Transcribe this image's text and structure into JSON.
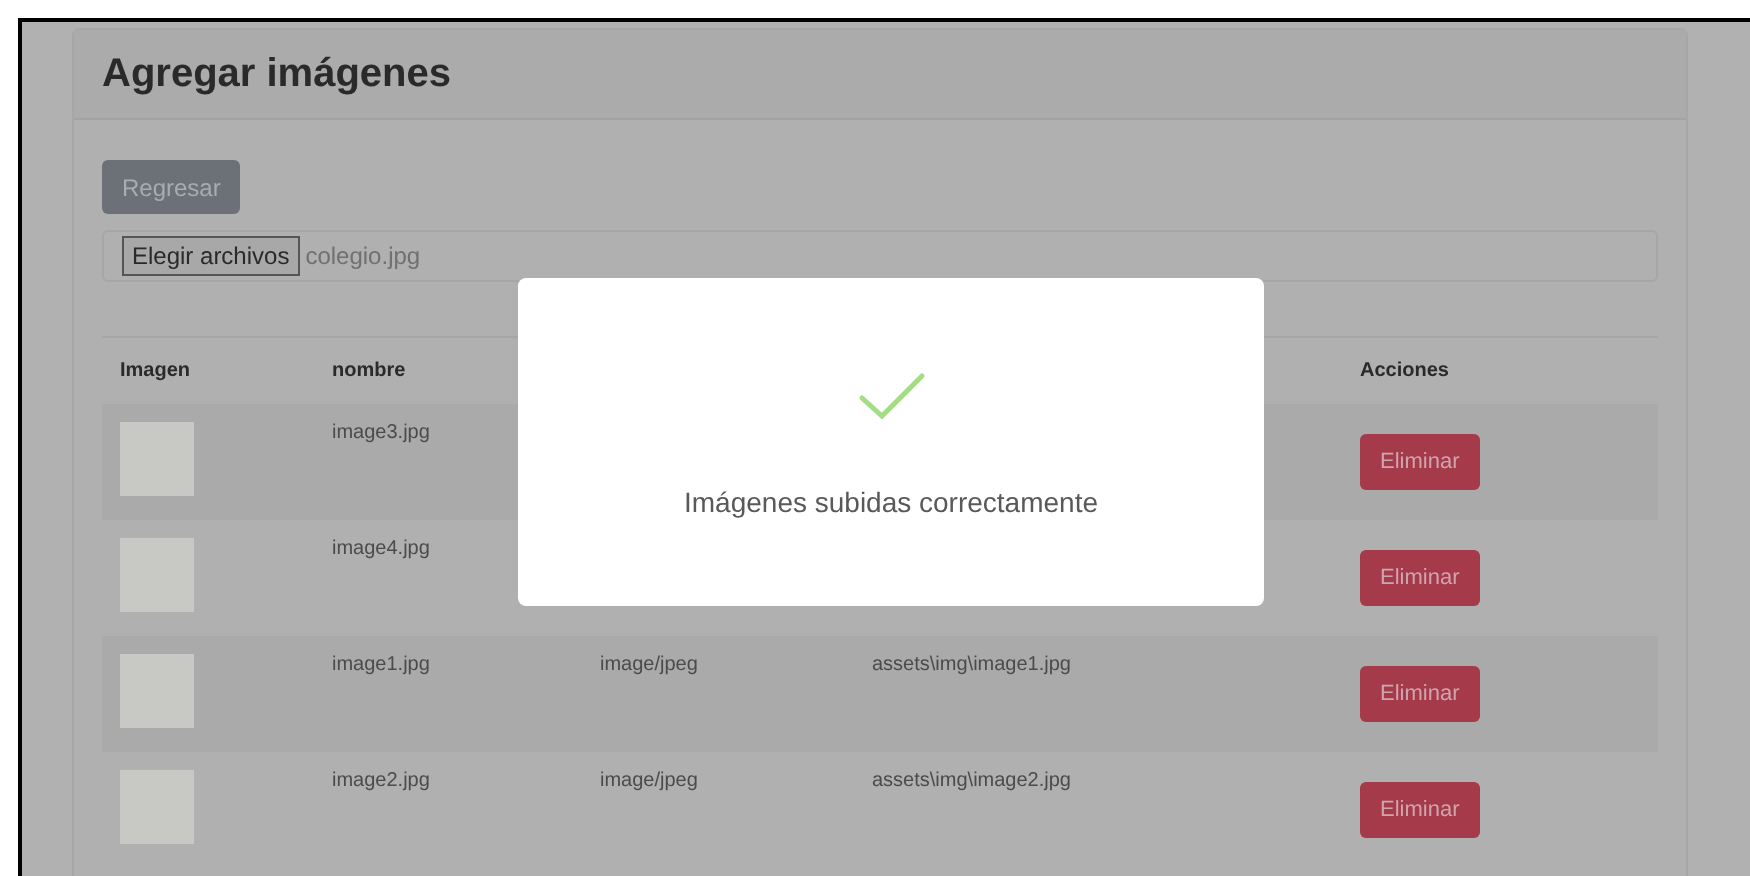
{
  "card": {
    "title": "Agregar imágenes"
  },
  "back_button": "Regresar",
  "file_input": {
    "button": "Elegir archivos",
    "value": "colegio.jpg"
  },
  "table": {
    "columns": [
      {
        "label": "Imagen"
      },
      {
        "label": "nombre"
      },
      {},
      {},
      {
        "label": "Acciones"
      }
    ],
    "rows": [
      {
        "name": "image3.jpg",
        "action": "Eliminar"
      },
      {
        "name": "image4.jpg",
        "action": "Eliminar"
      },
      {
        "name": "image1.jpg",
        "type": "image/jpeg",
        "path": "assets\\img\\image1.jpg",
        "action": "Eliminar"
      },
      {
        "name": "image2.jpg",
        "type": "image/jpeg",
        "path": "assets\\img\\image2.jpg",
        "action": "Eliminar"
      }
    ]
  },
  "modal": {
    "message": "Imágenes subidas correctamente"
  }
}
